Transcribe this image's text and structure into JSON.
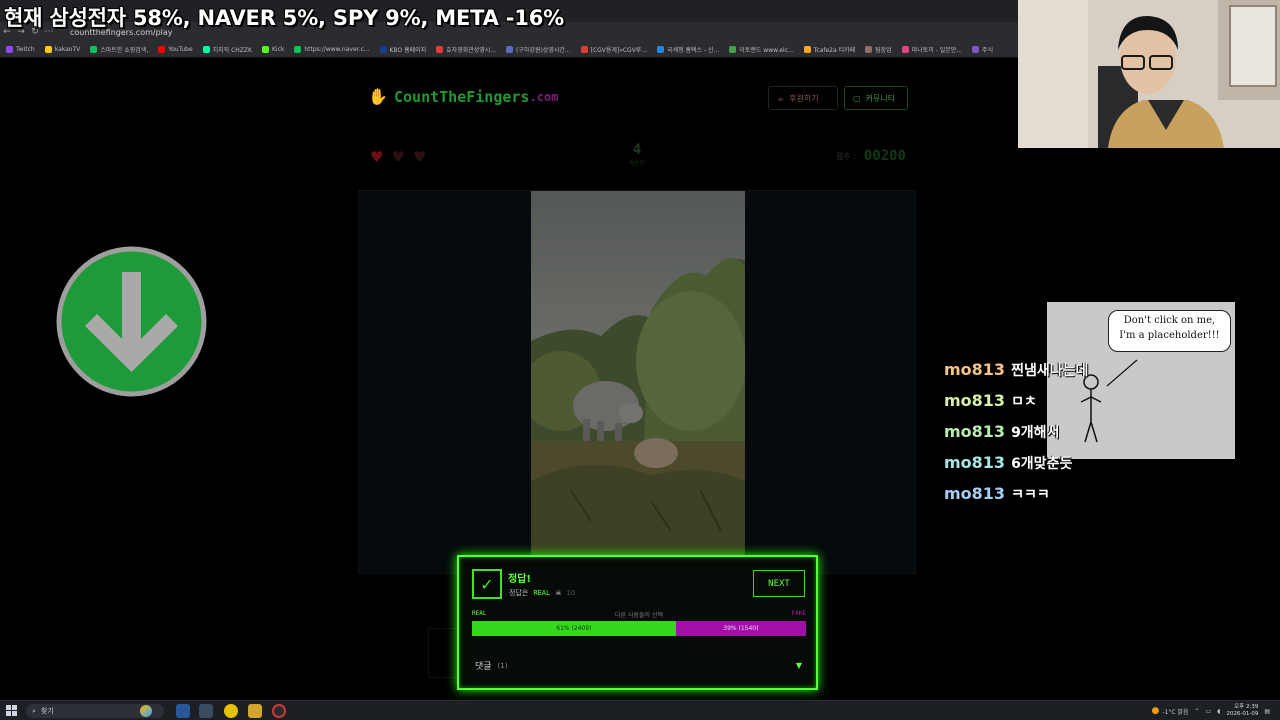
{
  "stream_overlay": {
    "title": "현재 삼성전자 58%, NAVER 5%, SPY 9%, META -16%"
  },
  "browser": {
    "url": "countthefingers.com/play",
    "bookmarks": [
      {
        "label": "Twitch",
        "color": "#9146ff"
      },
      {
        "label": "kakaoTV",
        "color": "#ffcd00"
      },
      {
        "label": "스마트한 쇼핑검색,",
        "color": "#03c75a"
      },
      {
        "label": "YouTube",
        "color": "#ff0000"
      },
      {
        "label": "치지직 CHZZK",
        "color": "#00ffa3"
      },
      {
        "label": "Kick",
        "color": "#53fc18"
      },
      {
        "label": "https://www.naver.c...",
        "color": "#03c75a"
      },
      {
        "label": "KBO 홈페이지",
        "color": "#1a3c8f"
      },
      {
        "label": "효자영화관상영시...",
        "color": "#e53935"
      },
      {
        "label": "(구하강원)상영시간...",
        "color": "#5c6bc0"
      },
      {
        "label": "[CGV용게]»CGV루...",
        "color": "#e53935"
      },
      {
        "label": "국세청 홈택스 - 신...",
        "color": "#1e88e5"
      },
      {
        "label": "이토랜드 www.elc...",
        "color": "#43a047"
      },
      {
        "label": "Tcafe2a 티카페",
        "color": "#f9a825"
      },
      {
        "label": "팀장업",
        "color": "#8d6e63"
      },
      {
        "label": "마나토끼 - 일본만...",
        "color": "#ec407a"
      },
      {
        "label": "주식",
        "color": "#7e57c2"
      }
    ]
  },
  "site": {
    "logo_main": "CountTheFingers",
    "logo_tld": ".com",
    "donate_label": "후원하기",
    "community_label": "커뮤니티"
  },
  "stats": {
    "lives_remaining": 1,
    "lives_total": 3,
    "round": "4",
    "round_label": "라운드",
    "score_label": "점수 :",
    "score": "00200"
  },
  "result": {
    "title": "정답!",
    "answer_prefix": "정답은",
    "answer": "REAL",
    "skull_icon": "skull-icon",
    "answer_count": "10",
    "next_label": "NEXT",
    "real_label": "REAL",
    "others_label": "다른 사람들의 선택",
    "fake_label": "FAKE",
    "real_fraction": 0.61,
    "real_text": "61% (2409)",
    "fake_text": "39% (1540)",
    "comments_label": "댓글",
    "comments_count": "(1)",
    "caret": "▼",
    "check": "✓"
  },
  "placeholder": {
    "line1": "Don't click on me,",
    "line2": "I'm a placeholder!!!"
  },
  "chat": [
    {
      "user": "mo813",
      "msg": "찐냄새나는데",
      "color": "#f4c38a"
    },
    {
      "user": "mo813",
      "msg": "ㅁㅊ",
      "color": "#d8f0a8"
    },
    {
      "user": "mo813",
      "msg": "9개해서",
      "color": "#b8ecb0"
    },
    {
      "user": "mo813",
      "msg": "6개맞춘듯",
      "color": "#a8e6e6"
    },
    {
      "user": "mo813",
      "msg": "ㅋㅋㅋ",
      "color": "#a8cdf2"
    }
  ],
  "taskbar": {
    "search_label": "찾기",
    "weather": "-1°C 맑음",
    "time": "오후 2:39",
    "date": "2026-01-09"
  }
}
